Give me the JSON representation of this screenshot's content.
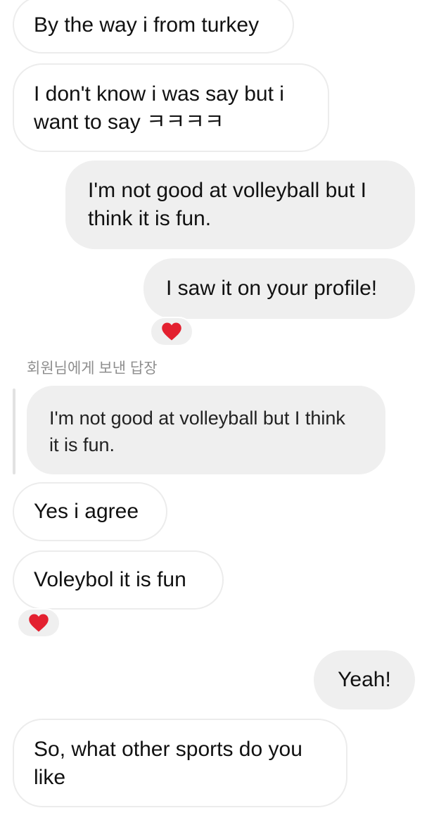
{
  "messages": [
    {
      "id": "m1",
      "direction": "received",
      "text": "By the way i from turkey"
    },
    {
      "id": "m2",
      "direction": "received",
      "text": "I don't know i was say but i\nwant to say ㅋㅋㅋㅋ"
    },
    {
      "id": "m3",
      "direction": "sent",
      "text": "I'm not good at volleyball but I\nthink it is fun."
    },
    {
      "id": "m4",
      "direction": "sent",
      "text": "I saw it on your profile!",
      "reaction": "heart"
    },
    {
      "id": "m6",
      "direction": "received",
      "text": "Yes i agree"
    },
    {
      "id": "m7",
      "direction": "received",
      "text": "Voleybol it is fun",
      "reaction": "heart"
    },
    {
      "id": "m8",
      "direction": "sent",
      "text": "Yeah!"
    },
    {
      "id": "m9",
      "direction": "received",
      "text": "So, what other sports do you\nlike"
    }
  ],
  "reply": {
    "label": "회원님에게 보낸 답장",
    "quoted_text": "I'm not good at volleyball but I think\nit is fun."
  },
  "colors": {
    "sent_bubble": "#efefef",
    "received_border": "#ececec",
    "heart": "#e3202f",
    "reply_label": "#8e8e8e"
  }
}
